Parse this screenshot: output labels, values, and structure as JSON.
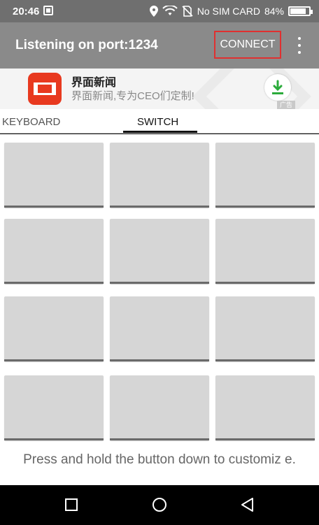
{
  "status_bar": {
    "time": "20:46",
    "sim": "No SIM CARD",
    "battery": "84%"
  },
  "app_bar": {
    "title": "Listening on port:1234",
    "connect_label": "CONNECT"
  },
  "ad": {
    "title": "界面新闻",
    "subtitle": "界面新闻,专为CEO们定制!",
    "badge": "广告",
    "logo_color": "#e8391f",
    "download_color": "#2bab3b"
  },
  "tabs": [
    {
      "label": "KEYBOARD",
      "selected": false
    },
    {
      "label": "SWITCH",
      "selected": true
    }
  ],
  "grid": {
    "rows": 4,
    "cols": 3
  },
  "hint": "Press and hold the button down to customiz e.",
  "colors": {
    "status_bar": "#6f6f6f",
    "app_bar": "#8a8a8a",
    "switch_button": "#d6d6d6",
    "connect_outline": "#e03030"
  }
}
